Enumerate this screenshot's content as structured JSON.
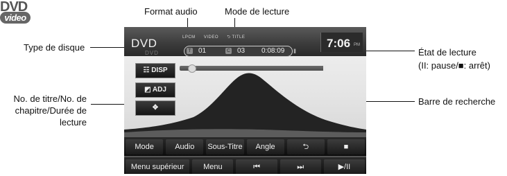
{
  "logo": {
    "top": "DVD",
    "bottom": "video"
  },
  "callouts": {
    "format_audio": "Format audio",
    "mode_lecture": "Mode de lecture",
    "type_disque": "Type de disque",
    "etat_lecture_1": "État de lecture",
    "etat_lecture_2": "(II: pause/■: arrêt)",
    "barre_recherche": "Barre de recherche",
    "titre_chapitre_1": "No. de titre/No. de",
    "titre_chapitre_2": "chapitre/Durée de",
    "titre_chapitre_3": "lecture"
  },
  "screen": {
    "disc_type": "DVD",
    "disc_sub": "DVD",
    "tags": [
      "LPCM",
      "VIDEO",
      "⮌ TITLE"
    ],
    "clock": "7:06",
    "ampm": "PM",
    "title_chip": "T",
    "title_no": "01",
    "chapter_chip": "C",
    "chapter_no": "03",
    "time": "0:08:09",
    "state_icon": "II",
    "side_buttons": {
      "disp": "☷ DISP",
      "adj": "◩ ADJ",
      "move": "✥"
    },
    "row1": [
      "Mode",
      "Audio",
      "Sous-Titre",
      "Angle",
      "⮌",
      "■"
    ],
    "row2": [
      "Menu supérieur",
      "Menu",
      "⏮",
      "⏭",
      "▶/II"
    ]
  },
  "colors": {
    "screen_dark": "#2a2a2a",
    "sky": "#e6e6e6",
    "mountain": "#222222"
  }
}
